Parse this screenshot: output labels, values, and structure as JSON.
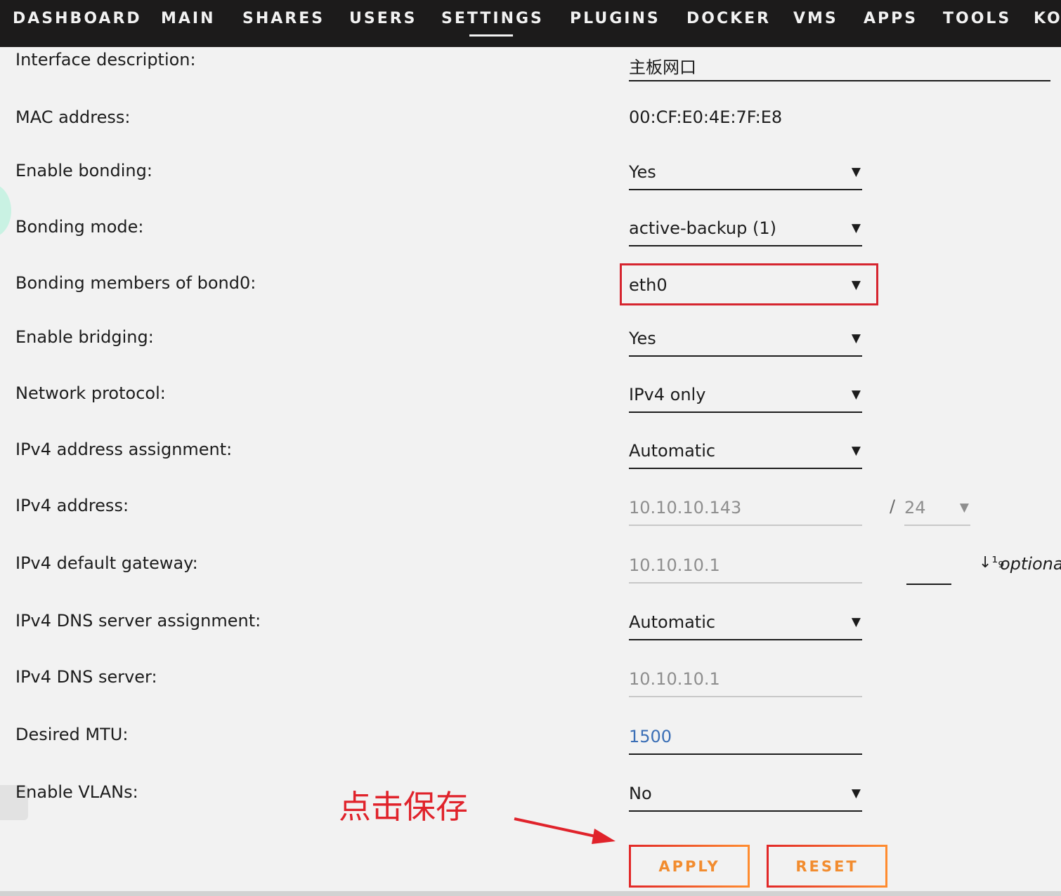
{
  "nav": {
    "items": [
      {
        "label": "DASHBOARD"
      },
      {
        "label": "MAIN"
      },
      {
        "label": "SHARES"
      },
      {
        "label": "USERS"
      },
      {
        "label": "SETTINGS"
      },
      {
        "label": "PLUGINS"
      },
      {
        "label": "DOCKER"
      },
      {
        "label": "VMS"
      },
      {
        "label": "APPS"
      },
      {
        "label": "TOOLS"
      },
      {
        "label": "KO"
      }
    ],
    "active": "SETTINGS"
  },
  "form": {
    "interface_description": {
      "label": "Interface description:",
      "value": "主板网口"
    },
    "mac_address": {
      "label": "MAC address:",
      "value": "00:CF:E0:4E:7F:E8"
    },
    "enable_bonding": {
      "label": "Enable bonding:",
      "value": "Yes"
    },
    "bonding_mode": {
      "label": "Bonding mode:",
      "value": "active-backup (1)"
    },
    "bonding_members": {
      "label": "Bonding members of bond0:",
      "value": "eth0"
    },
    "enable_bridging": {
      "label": "Enable bridging:",
      "value": "Yes"
    },
    "network_protocol": {
      "label": "Network protocol:",
      "value": "IPv4 only"
    },
    "ipv4_assignment": {
      "label": "IPv4 address assignment:",
      "value": "Automatic"
    },
    "ipv4_address": {
      "label": "IPv4 address:",
      "value": "10.10.10.143",
      "slash": "/",
      "prefix": "24"
    },
    "ipv4_gateway": {
      "label": "IPv4 default gateway:",
      "value": "10.10.10.1",
      "metric_icon": "↓¹₉",
      "optional": "optional"
    },
    "dns_assignment": {
      "label": "IPv4 DNS server assignment:",
      "value": "Automatic"
    },
    "dns_server": {
      "label": "IPv4 DNS server:",
      "value": "10.10.10.1"
    },
    "mtu": {
      "label": "Desired MTU:",
      "value": "1500"
    },
    "enable_vlans": {
      "label": "Enable VLANs:",
      "value": "No"
    }
  },
  "buttons": {
    "apply": "APPLY",
    "reset": "RESET"
  },
  "annotation": {
    "text": "点击保存"
  },
  "caret": "▼",
  "colors": {
    "nav_bg": "#1c1b1b",
    "page_bg": "#f2f2f2",
    "highlight": "#d6252f",
    "button_text": "#f28c2f",
    "mtu_value": "#3b6fb6",
    "disabled_text": "#8e8e8e"
  }
}
